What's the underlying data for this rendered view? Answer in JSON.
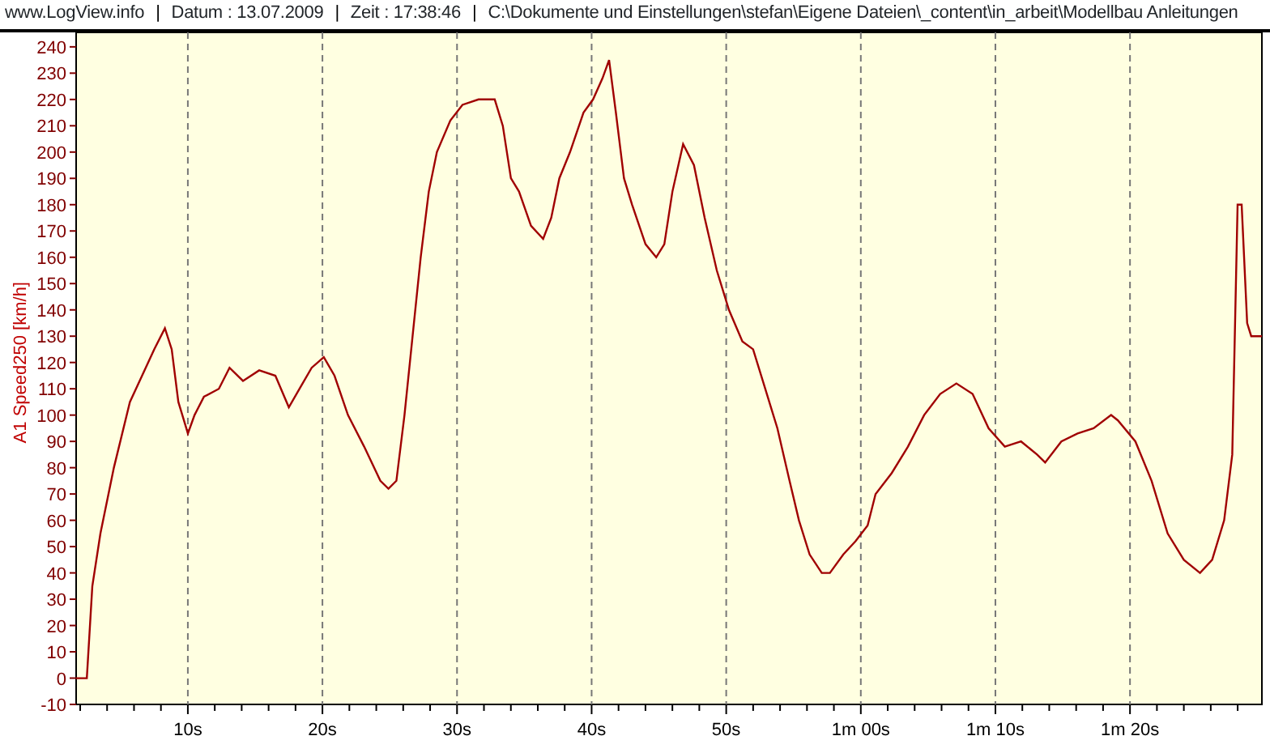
{
  "header": {
    "separators": [
      "|",
      "|",
      "|"
    ],
    "items": [
      "www.LogView.info",
      "Datum : 13.07.2009",
      "Zeit : 17:38:46",
      "C:\\Dokumente und Einstellungen\\stefan\\Eigene Dateien\\_content\\in_arbeit\\Modellbau Anleitungen"
    ]
  },
  "chart": {
    "chart_data": {
      "type": "line",
      "ylabel": "A1 Speed250 [km/h]",
      "x": [
        1.7,
        2.5,
        2.9,
        3.5,
        4.5,
        5.7,
        6.6,
        7.5,
        8.3,
        8.8,
        9.3,
        10,
        10.5,
        11.2,
        12.3,
        13.1,
        14.1,
        15.3,
        16.5,
        17.5,
        18.3,
        19.2,
        20.1,
        20.9,
        21.9,
        23.1,
        24.3,
        24.9,
        25.5,
        26.1,
        26.7,
        27.3,
        27.9,
        28.5,
        29.5,
        30.4,
        31.6,
        32.8,
        33.4,
        34,
        34.6,
        35.5,
        36.4,
        37,
        37.6,
        38.4,
        39.4,
        40.1,
        40.8,
        41.3,
        41.8,
        42.4,
        43,
        44,
        44.8,
        45.4,
        46,
        46.8,
        47.6,
        48.4,
        49.3,
        50.2,
        51.2,
        52,
        52.9,
        53.8,
        54.7,
        55.4,
        56.2,
        57.1,
        57.7,
        58.7,
        59.6,
        60.5,
        61.1,
        62.3,
        63.5,
        64.7,
        65.9,
        67.1,
        68.3,
        69.5,
        70.7,
        71.9,
        73.1,
        73.7,
        74.9,
        76.1,
        77.3,
        78.6,
        79.1,
        80.4,
        81.6,
        82.8,
        84,
        85.2,
        86.1,
        87,
        87.6,
        88,
        88.3,
        88.7,
        89,
        89.8
      ],
      "grid": true,
      "series": [
        {
          "color": "#a00000",
          "values": [
            0,
            0,
            35,
            55,
            80,
            105,
            115,
            125,
            133,
            125,
            105,
            93,
            100,
            107,
            110,
            118,
            113,
            117,
            115,
            103,
            110,
            118,
            122,
            115,
            100,
            88,
            75,
            72,
            75,
            100,
            130,
            160,
            185,
            200,
            212,
            218,
            220,
            220,
            210,
            190,
            185,
            172,
            167,
            175,
            190,
            200,
            215,
            220,
            228,
            235,
            215,
            190,
            180,
            165,
            160,
            165,
            185,
            203,
            195,
            175,
            155,
            140,
            128,
            125,
            110,
            95,
            75,
            60,
            47,
            40,
            40,
            47,
            52,
            58,
            70,
            78,
            88,
            100,
            108,
            112,
            108,
            95,
            88,
            90,
            85,
            82,
            90,
            93,
            95,
            100,
            98,
            90,
            75,
            55,
            45,
            40,
            45,
            60,
            85,
            180,
            180,
            135,
            130,
            130
          ]
        }
      ],
      "xlim": [
        1.7,
        89.8
      ],
      "ylim": [
        -10,
        245.5
      ],
      "xticks": [
        {
          "value": 10,
          "label": "10s"
        },
        {
          "value": 20,
          "label": "20s"
        },
        {
          "value": 30,
          "label": "30s"
        },
        {
          "value": 40,
          "label": "40s"
        },
        {
          "value": 50,
          "label": "50s"
        },
        {
          "value": 60,
          "label": "1m 00s"
        },
        {
          "value": 70,
          "label": "1m 10s"
        },
        {
          "value": 80,
          "label": "1m 20s"
        }
      ],
      "yticks": [
        -10,
        0,
        10,
        20,
        30,
        40,
        50,
        60,
        70,
        80,
        90,
        100,
        110,
        120,
        130,
        140,
        150,
        160,
        170,
        180,
        190,
        200,
        210,
        220,
        230,
        240
      ]
    }
  }
}
